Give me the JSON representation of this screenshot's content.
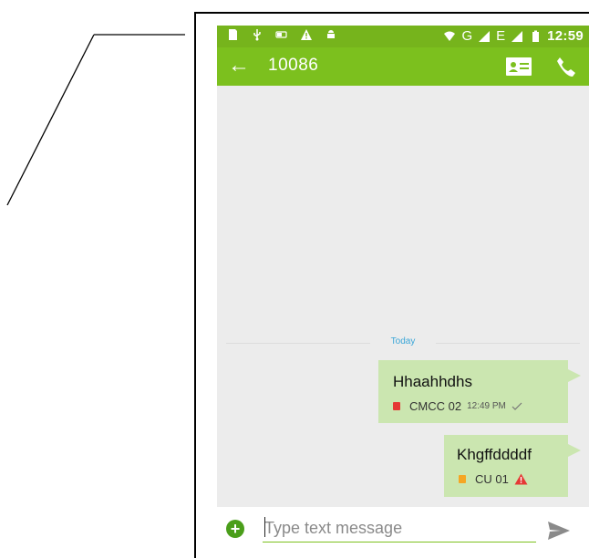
{
  "status_bar": {
    "left_icons": [
      "sd-card-icon",
      "usb-icon",
      "battery-saver-icon",
      "warning-icon",
      "android-debug-icon"
    ],
    "right_icons": [
      "wifi-icon",
      "signal-g-icon",
      "signal-e-icon",
      "battery-icon"
    ],
    "network_g": "G",
    "network_e": "E",
    "time": "12:59"
  },
  "app_bar": {
    "back_glyph": "←",
    "title": "10086",
    "color": "#7cc01e"
  },
  "conversation": {
    "date_divider": "Today",
    "messages": [
      {
        "text": "Hhaahhdhs",
        "sim_label": "CMCC 02",
        "sim_color": "#e53935",
        "time": "12:49 PM",
        "status": "delivered-check-icon"
      },
      {
        "text": "Khgffddddf",
        "sim_label": "CU 01",
        "sim_color": "#f5a623",
        "status": "failed-warning-icon",
        "status_color": "#e53935"
      }
    ]
  },
  "composer": {
    "plus_glyph": "+",
    "placeholder": "Type text message"
  }
}
